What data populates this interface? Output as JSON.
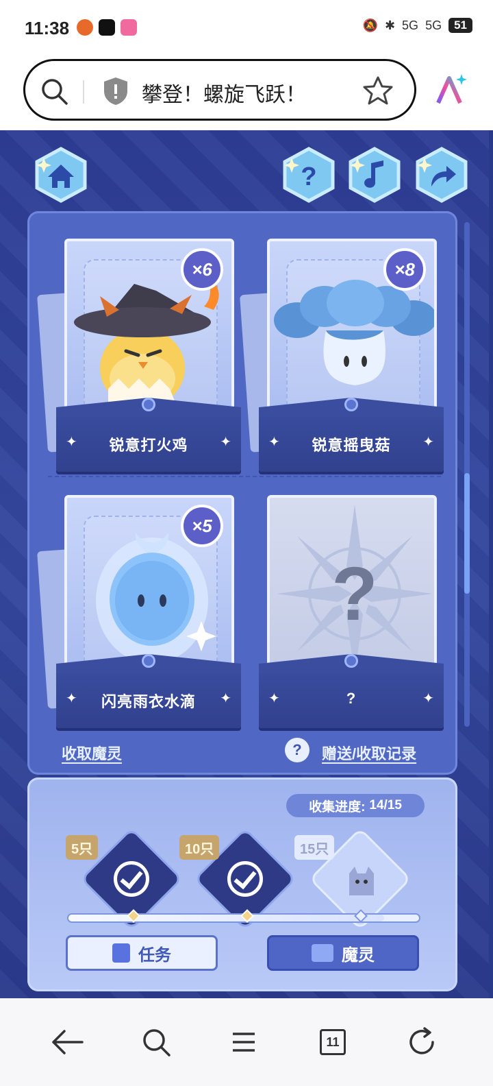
{
  "status_bar": {
    "time": "11:38",
    "signal1": "5G",
    "signal2": "5G",
    "battery": "51"
  },
  "browser": {
    "search_text": "攀登！螺旋飞跃！"
  },
  "game": {
    "cards": [
      {
        "name": "锐意打火鸡",
        "count": "×6"
      },
      {
        "name": "锐意摇曳菇",
        "count": "×8"
      },
      {
        "name": "闪亮雨衣水滴",
        "count": "×5"
      },
      {
        "name": "?",
        "count": "",
        "question_mark": "?"
      }
    ],
    "collect_link": "收取魔灵",
    "help_icon_text": "?",
    "record_link": "赠送/收取记录",
    "progress_label": "收集进度:",
    "progress_value": "14/15",
    "progress_fraction": 0.9,
    "milestones": [
      {
        "tag": "5只",
        "done": true
      },
      {
        "tag": "10只",
        "done": true
      },
      {
        "tag": "15只",
        "done": false
      }
    ],
    "task_button": "任务",
    "spirit_button": "魔灵"
  },
  "nav": {
    "tabs_count": "11"
  },
  "colors": {
    "game_bg": "#2d3d94",
    "panel": "#5068c4",
    "progress_panel": "#b9c9f7",
    "badge": "#5d5fc9"
  }
}
